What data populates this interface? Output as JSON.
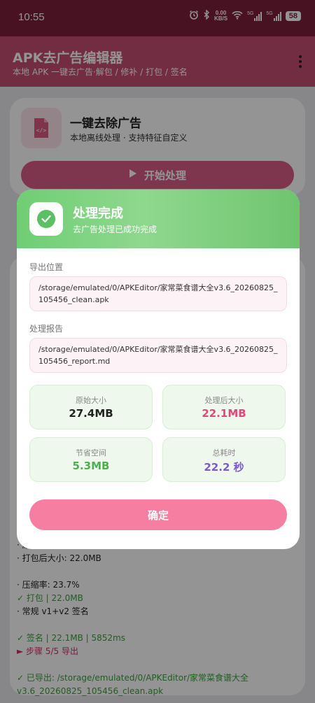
{
  "status_bar": {
    "time": "10:55",
    "net_speed_value": "0.00",
    "net_speed_unit": "KB/S",
    "signal1_label": "5G",
    "signal2_label": "5G",
    "battery": "58"
  },
  "app_bar": {
    "title": "APK去广告编辑器",
    "subtitle": "本地 APK 一键去广告·解包 / 修补 / 打包 / 签名"
  },
  "main_card": {
    "heading": "一键去除广告",
    "subheading": "本地离线处理 · 支持特征自定义",
    "start_button": "开始处理"
  },
  "log": {
    "lines": [
      {
        "text": "· 原始大小: 28.6MB",
        "tone": "normal"
      },
      {
        "text": "· 打包后大小: 22.0MB",
        "tone": "normal"
      },
      {
        "text": "",
        "tone": "normal"
      },
      {
        "text": "· 压缩率: 23.7%",
        "tone": "normal"
      },
      {
        "text": "✓ 打包 | 22.0MB",
        "tone": "green"
      },
      {
        "text": "· 常规 v1+v2 签名",
        "tone": "normal"
      },
      {
        "text": "",
        "tone": "normal"
      },
      {
        "text": "✓ 签名 | 22.1MB | 5852ms",
        "tone": "green"
      },
      {
        "text": "► 步骤 5/5 导出",
        "tone": "pink"
      },
      {
        "text": "",
        "tone": "normal"
      },
      {
        "text": "✓ 已导出: /storage/emulated/0/APKEditor/家常菜食谱大全",
        "tone": "green"
      },
      {
        "text": "v3.6_20260825_105456_clean.apk",
        "tone": "green"
      }
    ]
  },
  "dialog": {
    "title": "处理完成",
    "subtitle": "去广告处理已成功完成",
    "export_label": "导出位置",
    "export_path": "/storage/emulated/0/APKEditor/家常菜食谱大全v3.6_20260825_105456_clean.apk",
    "report_label": "处理报告",
    "report_path": "/storage/emulated/0/APKEditor/家常菜食谱大全v3.6_20260825_105456_report.md",
    "stats": {
      "original_label": "原始大小",
      "original_value": "27.4MB",
      "processed_label": "处理后大小",
      "processed_value": "22.1MB",
      "saved_label": "节省空间",
      "saved_value": "5.3MB",
      "time_label": "总耗时",
      "time_value": "22.2 秒"
    },
    "confirm_button": "确定"
  },
  "colors": {
    "primary": "#c44e72",
    "success": "#6fce74",
    "confirm": "#f57ea1",
    "processed_value": "#e0477a",
    "saved_value": "#4db04f",
    "time_value": "#7b5ad1"
  },
  "icons": {
    "status": [
      "alarm-icon",
      "bluetooth-icon",
      "wifi-icon",
      "signal-icon",
      "battery-icon"
    ],
    "app": [
      "more-vert-icon",
      "apk-file-icon",
      "play-icon",
      "check-circle-icon"
    ]
  }
}
